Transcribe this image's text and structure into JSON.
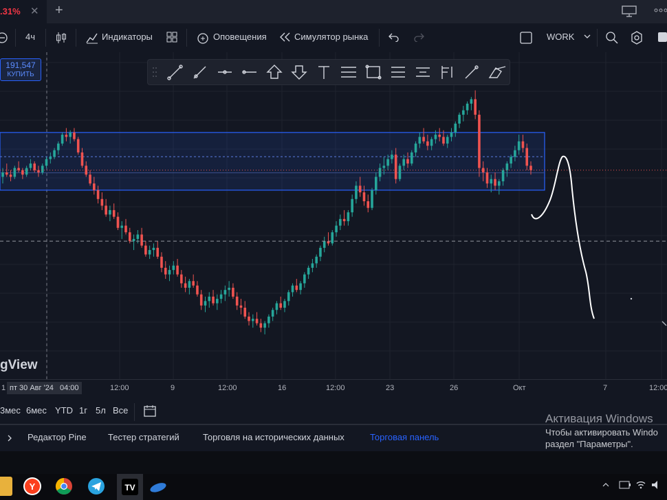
{
  "tabbar": {
    "tab_title": ".31%",
    "close_glyph": "✕",
    "new_tab_glyph": "+",
    "right_icons": [
      "monitor-icon",
      "more-icon"
    ]
  },
  "toolbar": {
    "interval": "4ч",
    "indicators": "Индикаторы",
    "alerts": "Оповещения",
    "replay": "Симулятор рынка",
    "layout_name": "WORK"
  },
  "drawing_toolbar": {
    "tools": [
      "trend-line-icon",
      "ray-icon",
      "horizontal-ray-icon",
      "horizontal-line-icon",
      "arrow-up-icon",
      "arrow-down-icon",
      "text-icon",
      "parallel-channel-icon",
      "rectangle-icon",
      "fib-retracement-icon",
      "fib-extension-icon",
      "pitchfork-icon",
      "brush-icon",
      "eraser-icon"
    ]
  },
  "buy_badge": {
    "price": "191,547",
    "label": "КУПИТЬ"
  },
  "watermark": "gView",
  "time_axis": {
    "crosshair_label": "пт 30 Авг '24",
    "crosshair_time": "04:00",
    "first_tick": "1",
    "labels": [
      "12:00",
      "9",
      "12:00",
      "16",
      "12:00",
      "23",
      "26",
      "Окт",
      "7",
      "12:00"
    ]
  },
  "range_bar": {
    "ranges": [
      "3мес",
      "6мес",
      "YTD",
      "1г",
      "5л",
      "Все"
    ]
  },
  "bottom_tabs": {
    "tabs": [
      "Редактор Pine",
      "Тестер стратегий",
      "Торговля на исторических данных",
      "Торговая панель"
    ],
    "active_tab_color": "#2962ff"
  },
  "windows_activation": {
    "title": "Активация Windows",
    "line1": "Чтобы активировать Windo",
    "line2": "раздел \"Параметры\"."
  },
  "colors": {
    "up": "#26a69a",
    "down": "#ef5350",
    "zone_border": "#2962ff",
    "background": "#131722"
  },
  "chart_data": {
    "type": "candlestick",
    "candles": [
      [
        180,
        184,
        177,
        182
      ],
      [
        182,
        186,
        180,
        181
      ],
      [
        181,
        183,
        178,
        180
      ],
      [
        180,
        185,
        179,
        184
      ],
      [
        184,
        187,
        182,
        183
      ],
      [
        183,
        184,
        179,
        181
      ],
      [
        181,
        185,
        180,
        184
      ],
      [
        184,
        188,
        183,
        186
      ],
      [
        186,
        187,
        182,
        183
      ],
      [
        183,
        185,
        180,
        182
      ],
      [
        182,
        186,
        181,
        185
      ],
      [
        185,
        189,
        184,
        188
      ],
      [
        188,
        191,
        186,
        189
      ],
      [
        189,
        193,
        188,
        192
      ],
      [
        192,
        196,
        190,
        195
      ],
      [
        195,
        200,
        194,
        199
      ],
      [
        199,
        202,
        196,
        198
      ],
      [
        198,
        201,
        195,
        200
      ],
      [
        200,
        202,
        196,
        197
      ],
      [
        197,
        198,
        190,
        191
      ],
      [
        191,
        193,
        184,
        185
      ],
      [
        185,
        187,
        180,
        181
      ],
      [
        181,
        183,
        176,
        177
      ],
      [
        177,
        180,
        172,
        174
      ],
      [
        174,
        176,
        168,
        170
      ],
      [
        170,
        173,
        165,
        167
      ],
      [
        167,
        170,
        162,
        163
      ],
      [
        163,
        167,
        160,
        165
      ],
      [
        165,
        168,
        161,
        162
      ],
      [
        162,
        164,
        156,
        157
      ],
      [
        157,
        160,
        152,
        158
      ],
      [
        158,
        161,
        154,
        155
      ],
      [
        155,
        157,
        150,
        151
      ],
      [
        151,
        154,
        147,
        152
      ],
      [
        152,
        156,
        150,
        154
      ],
      [
        154,
        157,
        148,
        149
      ],
      [
        149,
        151,
        144,
        145
      ],
      [
        145,
        149,
        143,
        147
      ],
      [
        147,
        150,
        144,
        148
      ],
      [
        148,
        151,
        143,
        144
      ],
      [
        144,
        146,
        137,
        139
      ],
      [
        139,
        142,
        134,
        136
      ],
      [
        136,
        140,
        133,
        138
      ],
      [
        138,
        142,
        136,
        140
      ],
      [
        140,
        143,
        135,
        136
      ],
      [
        136,
        138,
        130,
        132
      ],
      [
        132,
        135,
        128,
        130
      ],
      [
        130,
        134,
        127,
        133
      ],
      [
        133,
        136,
        130,
        131
      ],
      [
        131,
        133,
        126,
        127
      ],
      [
        127,
        129,
        120,
        122
      ],
      [
        122,
        126,
        119,
        124
      ],
      [
        124,
        128,
        121,
        126
      ],
      [
        126,
        129,
        122,
        123
      ],
      [
        123,
        127,
        120,
        125
      ],
      [
        125,
        129,
        123,
        127
      ],
      [
        127,
        131,
        124,
        129
      ],
      [
        129,
        133,
        126,
        130
      ],
      [
        130,
        132,
        125,
        126
      ],
      [
        126,
        128,
        120,
        122
      ],
      [
        122,
        125,
        118,
        121
      ],
      [
        121,
        124,
        116,
        117
      ],
      [
        117,
        119,
        113,
        115
      ],
      [
        115,
        118,
        112,
        116
      ],
      [
        116,
        119,
        113,
        114
      ],
      [
        114,
        116,
        110,
        112
      ],
      [
        112,
        115,
        109,
        114
      ],
      [
        114,
        118,
        112,
        117
      ],
      [
        117,
        121,
        115,
        120
      ],
      [
        120,
        124,
        118,
        123
      ],
      [
        123,
        126,
        120,
        121
      ],
      [
        121,
        125,
        119,
        124
      ],
      [
        124,
        129,
        122,
        128
      ],
      [
        128,
        132,
        126,
        131
      ],
      [
        131,
        134,
        128,
        129
      ],
      [
        129,
        133,
        127,
        132
      ],
      [
        132,
        137,
        130,
        136
      ],
      [
        136,
        140,
        134,
        139
      ],
      [
        139,
        143,
        137,
        141
      ],
      [
        141,
        145,
        139,
        144
      ],
      [
        144,
        149,
        142,
        148
      ],
      [
        148,
        153,
        146,
        151
      ],
      [
        151,
        155,
        149,
        150
      ],
      [
        150,
        156,
        149,
        155
      ],
      [
        155,
        160,
        153,
        158
      ],
      [
        158,
        163,
        156,
        161
      ],
      [
        161,
        165,
        158,
        160
      ],
      [
        160,
        165,
        158,
        164
      ],
      [
        164,
        172,
        162,
        170
      ],
      [
        170,
        178,
        168,
        176
      ],
      [
        176,
        180,
        171,
        173
      ],
      [
        173,
        176,
        167,
        169
      ],
      [
        169,
        172,
        164,
        166
      ],
      [
        166,
        175,
        165,
        174
      ],
      [
        174,
        182,
        172,
        180
      ],
      [
        180,
        186,
        178,
        184
      ],
      [
        184,
        189,
        181,
        185
      ],
      [
        185,
        190,
        183,
        188
      ],
      [
        188,
        192,
        186,
        190
      ],
      [
        190,
        193,
        177,
        179
      ],
      [
        179,
        186,
        178,
        185
      ],
      [
        185,
        190,
        183,
        188
      ],
      [
        188,
        191,
        184,
        186
      ],
      [
        186,
        192,
        185,
        191
      ],
      [
        191,
        196,
        189,
        195
      ],
      [
        195,
        200,
        193,
        198
      ],
      [
        198,
        202,
        195,
        196
      ],
      [
        196,
        199,
        192,
        194
      ],
      [
        194,
        198,
        192,
        197
      ],
      [
        197,
        201,
        195,
        199
      ],
      [
        199,
        202,
        196,
        198
      ],
      [
        198,
        201,
        194,
        195
      ],
      [
        195,
        199,
        193,
        198
      ],
      [
        198,
        202,
        196,
        200
      ],
      [
        200,
        205,
        198,
        204
      ],
      [
        204,
        209,
        202,
        208
      ],
      [
        208,
        212,
        205,
        210
      ],
      [
        210,
        214,
        208,
        213
      ],
      [
        213,
        216,
        210,
        215
      ],
      [
        215,
        219,
        206,
        208
      ],
      [
        208,
        210,
        180,
        184
      ],
      [
        184,
        187,
        178,
        182
      ],
      [
        182,
        184,
        175,
        177
      ],
      [
        177,
        181,
        173,
        179
      ],
      [
        179,
        182,
        174,
        176
      ],
      [
        176,
        179,
        172,
        178
      ],
      [
        178,
        184,
        176,
        183
      ],
      [
        183,
        187,
        180,
        186
      ],
      [
        186,
        190,
        184,
        189
      ],
      [
        189,
        194,
        187,
        192
      ],
      [
        192,
        199,
        190,
        196
      ],
      [
        196,
        199,
        191,
        193
      ],
      [
        193,
        195,
        183,
        185
      ],
      [
        185,
        187,
        181,
        183
      ]
    ],
    "zone": {
      "low": 174,
      "high": 200
    },
    "dashed_level": 151
  }
}
